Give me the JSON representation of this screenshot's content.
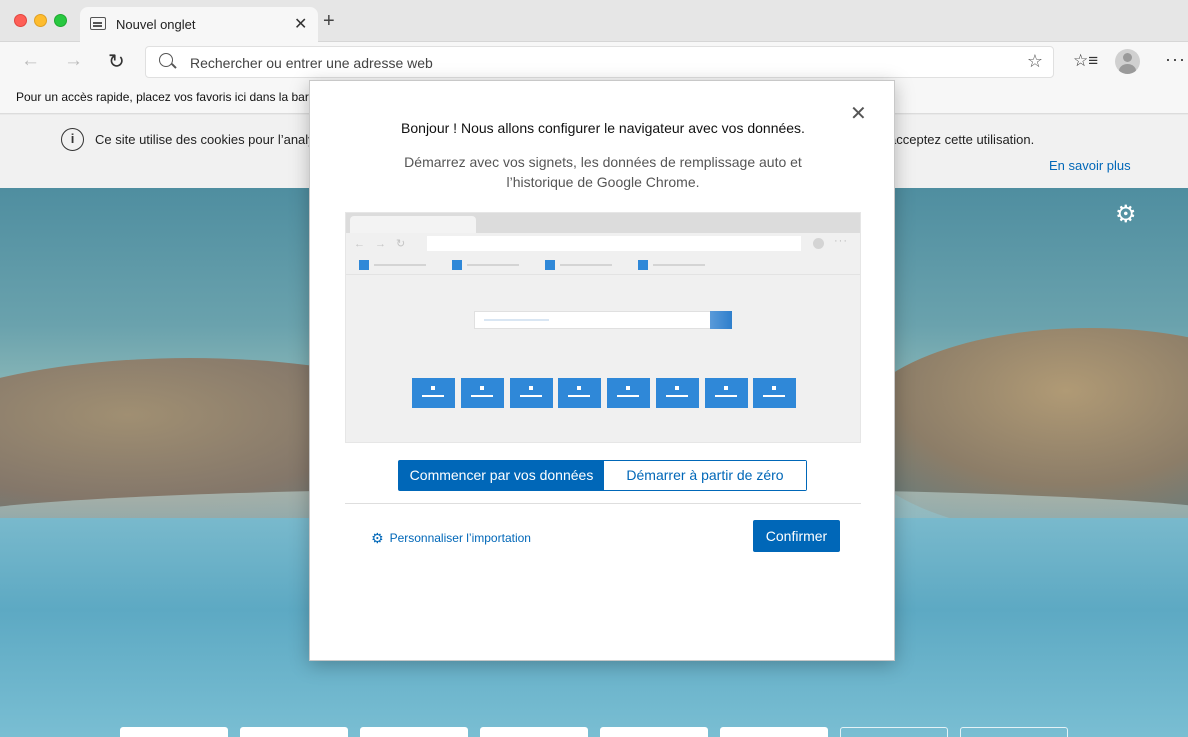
{
  "browser": {
    "tab": {
      "title": "Nouvel onglet",
      "close": "✕"
    },
    "new_tab": "+",
    "nav": {
      "back": "←",
      "forward": "→",
      "reload": "↻"
    },
    "address_bar": {
      "placeholder": "Rechercher ou entrer une adresse web",
      "value": ""
    },
    "icons": {
      "favorite": "☆",
      "favorites_list": "☆≡",
      "more": "···"
    }
  },
  "favorites_bar": {
    "text": "Pour un accès rapide, placez vos favoris ici dans la barre"
  },
  "cookie_banner": {
    "info": "i",
    "text_left": "Ce site utilise des cookies pour l’analy",
    "text_right": "acceptez cette utilisation.",
    "learn_more": "En savoir plus"
  },
  "newtab": {
    "settings_icon": "⚙"
  },
  "dialog": {
    "close": "✕",
    "title": "Bonjour ! Nous allons configurer le navigateur avec vos données.",
    "subtitle": "Démarrez avec vos signets, les données de remplissage auto et l’historique de Google Chrome.",
    "options": {
      "use_data": "Commencer par vos données",
      "from_scratch": "Démarrer à partir de zéro",
      "selected": "use_data"
    },
    "customize": {
      "icon": "⚙",
      "label": "Personnaliser l’importation"
    },
    "confirm": "Confirmer"
  },
  "colors": {
    "accent": "#0067b8",
    "illustration_blue": "#2f88d8"
  }
}
